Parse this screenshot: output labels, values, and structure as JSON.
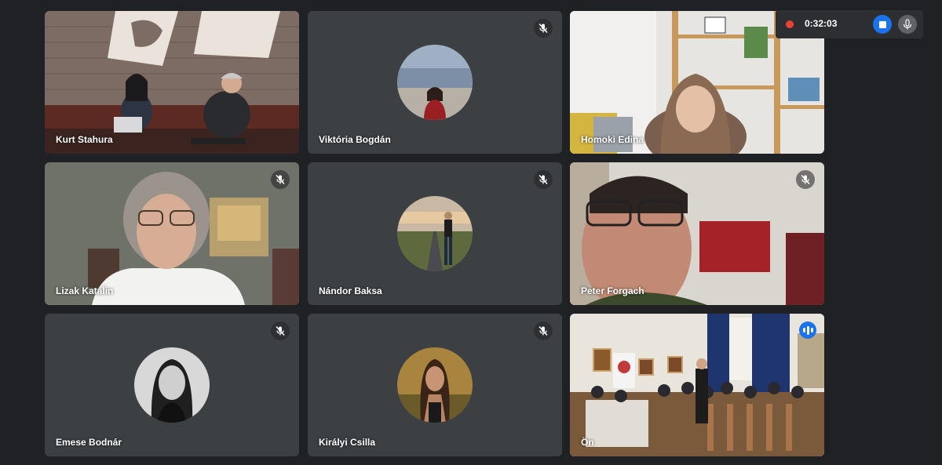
{
  "recording": {
    "time": "0:32:03"
  },
  "participants": [
    {
      "name": "Kurt Stahura",
      "muted": false,
      "type": "video"
    },
    {
      "name": "Viktória Bogdán",
      "muted": true,
      "type": "avatar"
    },
    {
      "name": "Homoki Edina",
      "muted": false,
      "type": "video"
    },
    {
      "name": "Lizak Katalin",
      "muted": true,
      "type": "video"
    },
    {
      "name": "Nándor Baksa",
      "muted": true,
      "type": "avatar"
    },
    {
      "name": "Peter Forgach",
      "muted": true,
      "type": "video"
    },
    {
      "name": "Emese Bodnár",
      "muted": true,
      "type": "avatar"
    },
    {
      "name": "Királyi Csilla",
      "muted": true,
      "type": "avatar"
    },
    {
      "name": "Ön",
      "muted": false,
      "type": "video",
      "speaking": true
    }
  ],
  "icons": {
    "mute": "mic-off-icon",
    "record": "record-dot-icon",
    "stop": "stop-icon",
    "mic": "mic-icon",
    "speaking": "speaking-indicator-icon"
  },
  "colors": {
    "record_red": "#ea4335",
    "accent_blue": "#1a73e8",
    "active_outline": "#8ab4f8"
  }
}
